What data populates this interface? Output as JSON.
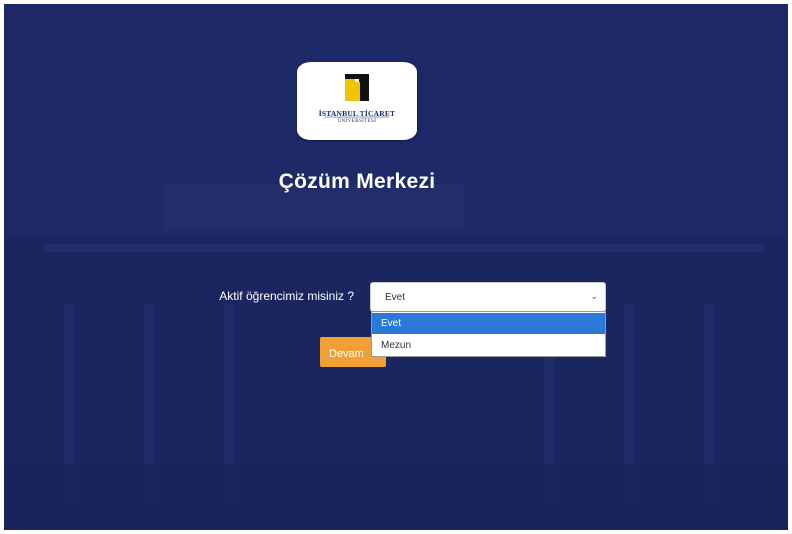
{
  "logo": {
    "line1": "İSTANBUL TİCARET",
    "line2": "ÜNİVERSİTESİ"
  },
  "page": {
    "title": "Çözüm Merkezi"
  },
  "form": {
    "question": "Aktif öğrencimiz misiniz ?",
    "select_value": "Evet",
    "options": [
      "Evet",
      "Mezun"
    ],
    "submit_label": "Devam"
  },
  "colors": {
    "background": "#1e2a68",
    "accent_button": "#f0a035",
    "option_highlight": "#2b79d8",
    "logo_gold": "#f2c300"
  },
  "icons": {
    "select_arrow": "chevron-down-icon"
  }
}
